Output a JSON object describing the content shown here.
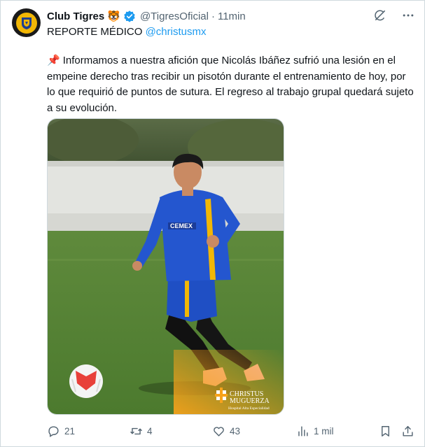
{
  "tweet": {
    "author_name": "Club Tigres",
    "author_emoji": "🐯",
    "handle": "@TigresOficial",
    "separator": "·",
    "time": "11min",
    "subtitle_text": "REPORTE MÉDICO",
    "subtitle_mention": "@christusmx",
    "pin_emoji": "📌",
    "body": "Informamos a nuestra afición que Nicolás Ibáñez sufrió una lesión en el empeine derecho tras recibir un pisotón durante el entrenamiento de hoy, por lo que requirió de puntos de sutura. El regreso al trabajo grupal quedará sujeto a su evolución.",
    "image": {
      "shirt_sponsor": "CEMEX",
      "watermark_brand": "CHRISTUS",
      "watermark_brand2": "MUGUERZA",
      "watermark_sub": "Hospital Alta Especialidad"
    },
    "stats": {
      "replies": "21",
      "reposts": "4",
      "likes": "43",
      "views": "1 mil"
    }
  },
  "icons": {
    "verified": "verified-badge-icon",
    "grok": "grok-icon",
    "more": "more-icon",
    "reply": "reply-icon",
    "repost": "repost-icon",
    "like": "like-icon",
    "views": "views-icon",
    "bookmark": "bookmark-icon",
    "share": "share-icon"
  },
  "colors": {
    "accent": "#1d9bf0",
    "secondary_text": "#536471",
    "tigres_yellow": "#f2b705",
    "kit_blue": "#1f4fc4"
  }
}
